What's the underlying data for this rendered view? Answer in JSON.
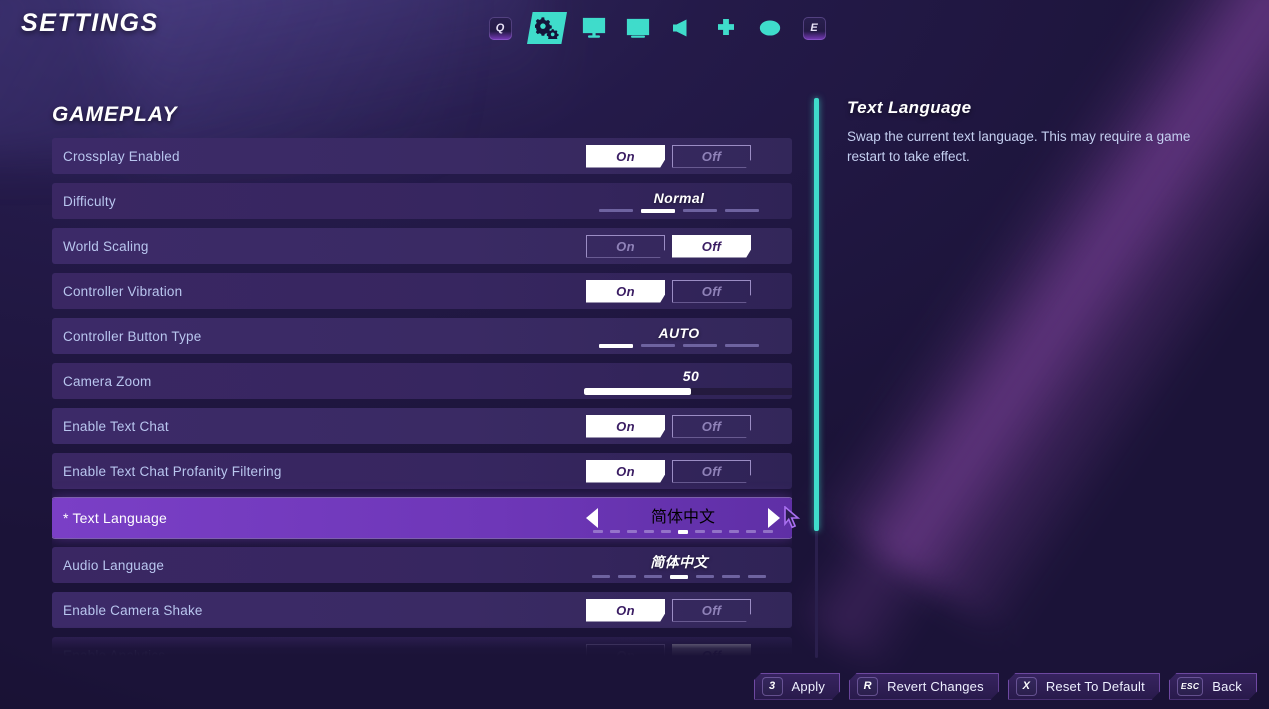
{
  "header": {
    "title": "SETTINGS",
    "tabs": [
      {
        "name": "bumper-left",
        "icon": "q-bumper-icon",
        "label": "Q",
        "selected": false
      },
      {
        "name": "gameplay",
        "icon": "gears-icon",
        "label": "Gameplay",
        "selected": true
      },
      {
        "name": "display",
        "icon": "monitor-icon",
        "label": "Display",
        "selected": false
      },
      {
        "name": "graphics",
        "icon": "image-icon",
        "label": "Graphics",
        "selected": false
      },
      {
        "name": "audio",
        "icon": "speaker-icon",
        "label": "Audio",
        "selected": false
      },
      {
        "name": "controls",
        "icon": "dpad-icon",
        "label": "Controls",
        "selected": false
      },
      {
        "name": "accessibility",
        "icon": "eye-icon",
        "label": "Accessibility",
        "selected": false
      },
      {
        "name": "bumper-right",
        "icon": "e-bumper-icon",
        "label": "E",
        "selected": false
      }
    ]
  },
  "section": {
    "title": "GAMEPLAY"
  },
  "settings": [
    {
      "label": "Crossplay Enabled",
      "type": "toggle",
      "on_label": "On",
      "off_label": "Off",
      "value": "On"
    },
    {
      "label": "Difficulty",
      "type": "stepper",
      "value": "Normal",
      "segments": 4,
      "active": 2
    },
    {
      "label": "World Scaling",
      "type": "toggle",
      "on_label": "On",
      "off_label": "Off",
      "value": "Off"
    },
    {
      "label": "Controller Vibration",
      "type": "toggle",
      "on_label": "On",
      "off_label": "Off",
      "value": "On"
    },
    {
      "label": "Controller Button Type",
      "type": "stepper",
      "value": "AUTO",
      "segments": 4,
      "active": 1
    },
    {
      "label": "Camera Zoom",
      "type": "slider",
      "value": "50",
      "percent": 50
    },
    {
      "label": "Enable Text Chat",
      "type": "toggle",
      "on_label": "On",
      "off_label": "Off",
      "value": "On"
    },
    {
      "label": "Enable Text Chat Profanity Filtering",
      "type": "toggle",
      "on_label": "On",
      "off_label": "Off",
      "value": "On"
    },
    {
      "label": "* Text Language",
      "type": "stepper-arrows",
      "value": "简体中文",
      "segments": 11,
      "active": 6,
      "selected": true
    },
    {
      "label": "Audio Language",
      "type": "stepper",
      "value": "简体中文",
      "segments": 7,
      "active": 4
    },
    {
      "label": "Enable Camera Shake",
      "type": "toggle",
      "on_label": "On",
      "off_label": "Off",
      "value": "On"
    },
    {
      "label": "Enable Analytics",
      "type": "toggle",
      "on_label": "On",
      "off_label": "Off",
      "value": "Off"
    }
  ],
  "info": {
    "title": "Text Language",
    "description": "Swap the current text language. This may require a game restart to take effect."
  },
  "footer": {
    "buttons": [
      {
        "key": "3",
        "label": "Apply"
      },
      {
        "key": "R",
        "label": "Revert Changes"
      },
      {
        "key": "X",
        "label": "Reset To Default"
      },
      {
        "key": "ESC",
        "label": "Back"
      }
    ]
  },
  "colors": {
    "accent_teal": "#3fdccb",
    "row_purple": "#3a2a64",
    "selected_purple": "#7a3fc6",
    "background": "#1b1338",
    "label_text": "#b9c6ef"
  }
}
